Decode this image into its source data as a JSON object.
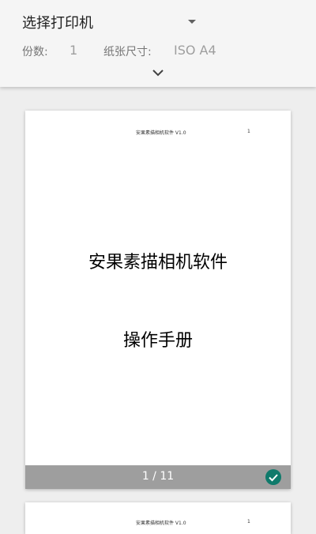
{
  "header": {
    "printer_select_label": "选择打印机",
    "dropdown_icon": "triangle-down-icon",
    "copies_label": "份数:",
    "copies_value": "1",
    "paper_size_label": "纸张尺寸:",
    "paper_size_value": "ISO A4",
    "expand_icon": "chevron-down-icon"
  },
  "preview": {
    "pages": [
      {
        "header_title": "安果素描相机软件 V1.0",
        "header_page_number": "1",
        "title": "安果素描相机软件",
        "subtitle": "操作手册",
        "page_counter": "1 / 11",
        "selected": true
      },
      {
        "header_title": "安果素描相机软件 V1.0",
        "header_page_number": "1"
      }
    ]
  },
  "colors": {
    "accent": "#0f7a6b",
    "footer_bar": "#9e9e9e"
  }
}
